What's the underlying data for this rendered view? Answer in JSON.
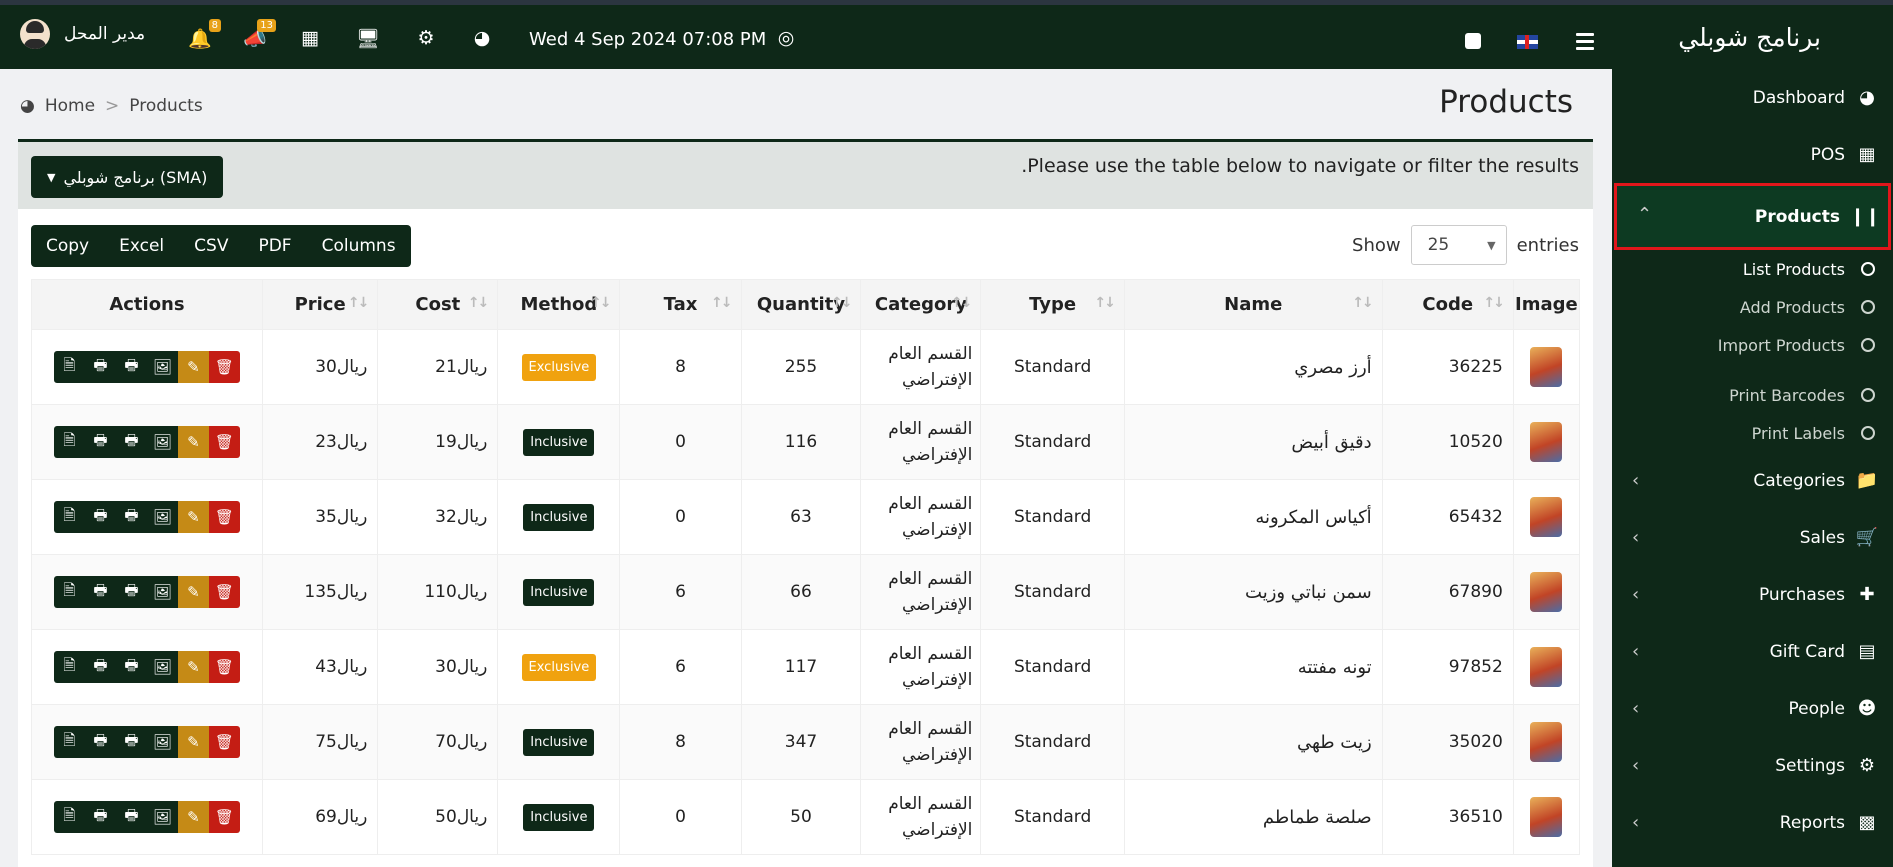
{
  "header": {
    "user_name": "مدير المحل",
    "notifications_count": "8",
    "announcements_count": "13",
    "datetime": "Wed 4 Sep 2024 07:08 PM"
  },
  "sidebar": {
    "brand": "برنامج شوبلي",
    "items": [
      {
        "label": "Dashboard",
        "icon": "dashboard-icon"
      },
      {
        "label": "POS",
        "icon": "grid-icon"
      },
      {
        "label": "Products",
        "icon": "barcode-icon"
      },
      {
        "label": "Categories",
        "icon": "folder-icon"
      },
      {
        "label": "Sales",
        "icon": "cart-icon"
      },
      {
        "label": "Purchases",
        "icon": "plus-icon"
      },
      {
        "label": "Gift Card",
        "icon": "card-icon"
      },
      {
        "label": "People",
        "icon": "users-icon"
      },
      {
        "label": "Settings",
        "icon": "cogs-icon"
      },
      {
        "label": "Reports",
        "icon": "bar-chart-icon"
      }
    ],
    "sub_items": [
      "List Products",
      "Add Products",
      "Import Products",
      "Print Barcodes",
      "Print Labels"
    ]
  },
  "breadcrumb": {
    "home": "Home",
    "current": "Products"
  },
  "page_title": "Products",
  "panel": {
    "info": ".Please use the table below to navigate or filter the results",
    "warehouse_button": "برنامج شوبلي (SMA)"
  },
  "toolbar": {
    "copy": "Copy",
    "excel": "Excel",
    "csv": "CSV",
    "pdf": "PDF",
    "columns": "Columns"
  },
  "show": {
    "label": "Show",
    "value": "25",
    "suffix": "entries"
  },
  "table": {
    "headers": {
      "image": "Image",
      "code": "Code",
      "name": "Name",
      "type": "Type",
      "category": "Category",
      "quantity": "Quantity",
      "tax": "Tax",
      "method": "Method",
      "cost": "Cost",
      "price": "Price",
      "actions": "Actions"
    },
    "rows": [
      {
        "code": "36225",
        "name": "أرز مصري",
        "type": "Standard",
        "category": "القسم العام الإفتراضي",
        "quantity": "255",
        "tax": "8",
        "method": "Exclusive",
        "cost": "21ريال",
        "price": "30ريال"
      },
      {
        "code": "10520",
        "name": "دقيق أبيض",
        "type": "Standard",
        "category": "القسم العام الإفتراضي",
        "quantity": "116",
        "tax": "0",
        "method": "Inclusive",
        "cost": "19ريال",
        "price": "23ريال"
      },
      {
        "code": "65432",
        "name": "أكياس المكرونه",
        "type": "Standard",
        "category": "القسم العام الإفتراضي",
        "quantity": "63",
        "tax": "0",
        "method": "Inclusive",
        "cost": "32ريال",
        "price": "35ريال"
      },
      {
        "code": "67890",
        "name": "سمن نباتي وزيت",
        "type": "Standard",
        "category": "القسم العام الإفتراضي",
        "quantity": "66",
        "tax": "6",
        "method": "Inclusive",
        "cost": "110ريال",
        "price": "135ريال"
      },
      {
        "code": "97852",
        "name": "تونه مفتته",
        "type": "Standard",
        "category": "القسم العام الإفتراضي",
        "quantity": "117",
        "tax": "6",
        "method": "Exclusive",
        "cost": "30ريال",
        "price": "43ريال"
      },
      {
        "code": "35020",
        "name": "زيت طهي",
        "type": "Standard",
        "category": "القسم العام الإفتراضي",
        "quantity": "347",
        "tax": "8",
        "method": "Inclusive",
        "cost": "70ريال",
        "price": "75ريال"
      },
      {
        "code": "36510",
        "name": "صلصة طماطم",
        "type": "Standard",
        "category": "القسم العام الإفتراضي",
        "quantity": "50",
        "tax": "0",
        "method": "Inclusive",
        "cost": "50ريال",
        "price": "69ريال"
      }
    ]
  },
  "colors": {
    "primary": "#0e2818",
    "exclusive": "#f0a20f",
    "edit": "#c58a16",
    "delete": "#c41d14",
    "highlight": "#e1161b"
  }
}
